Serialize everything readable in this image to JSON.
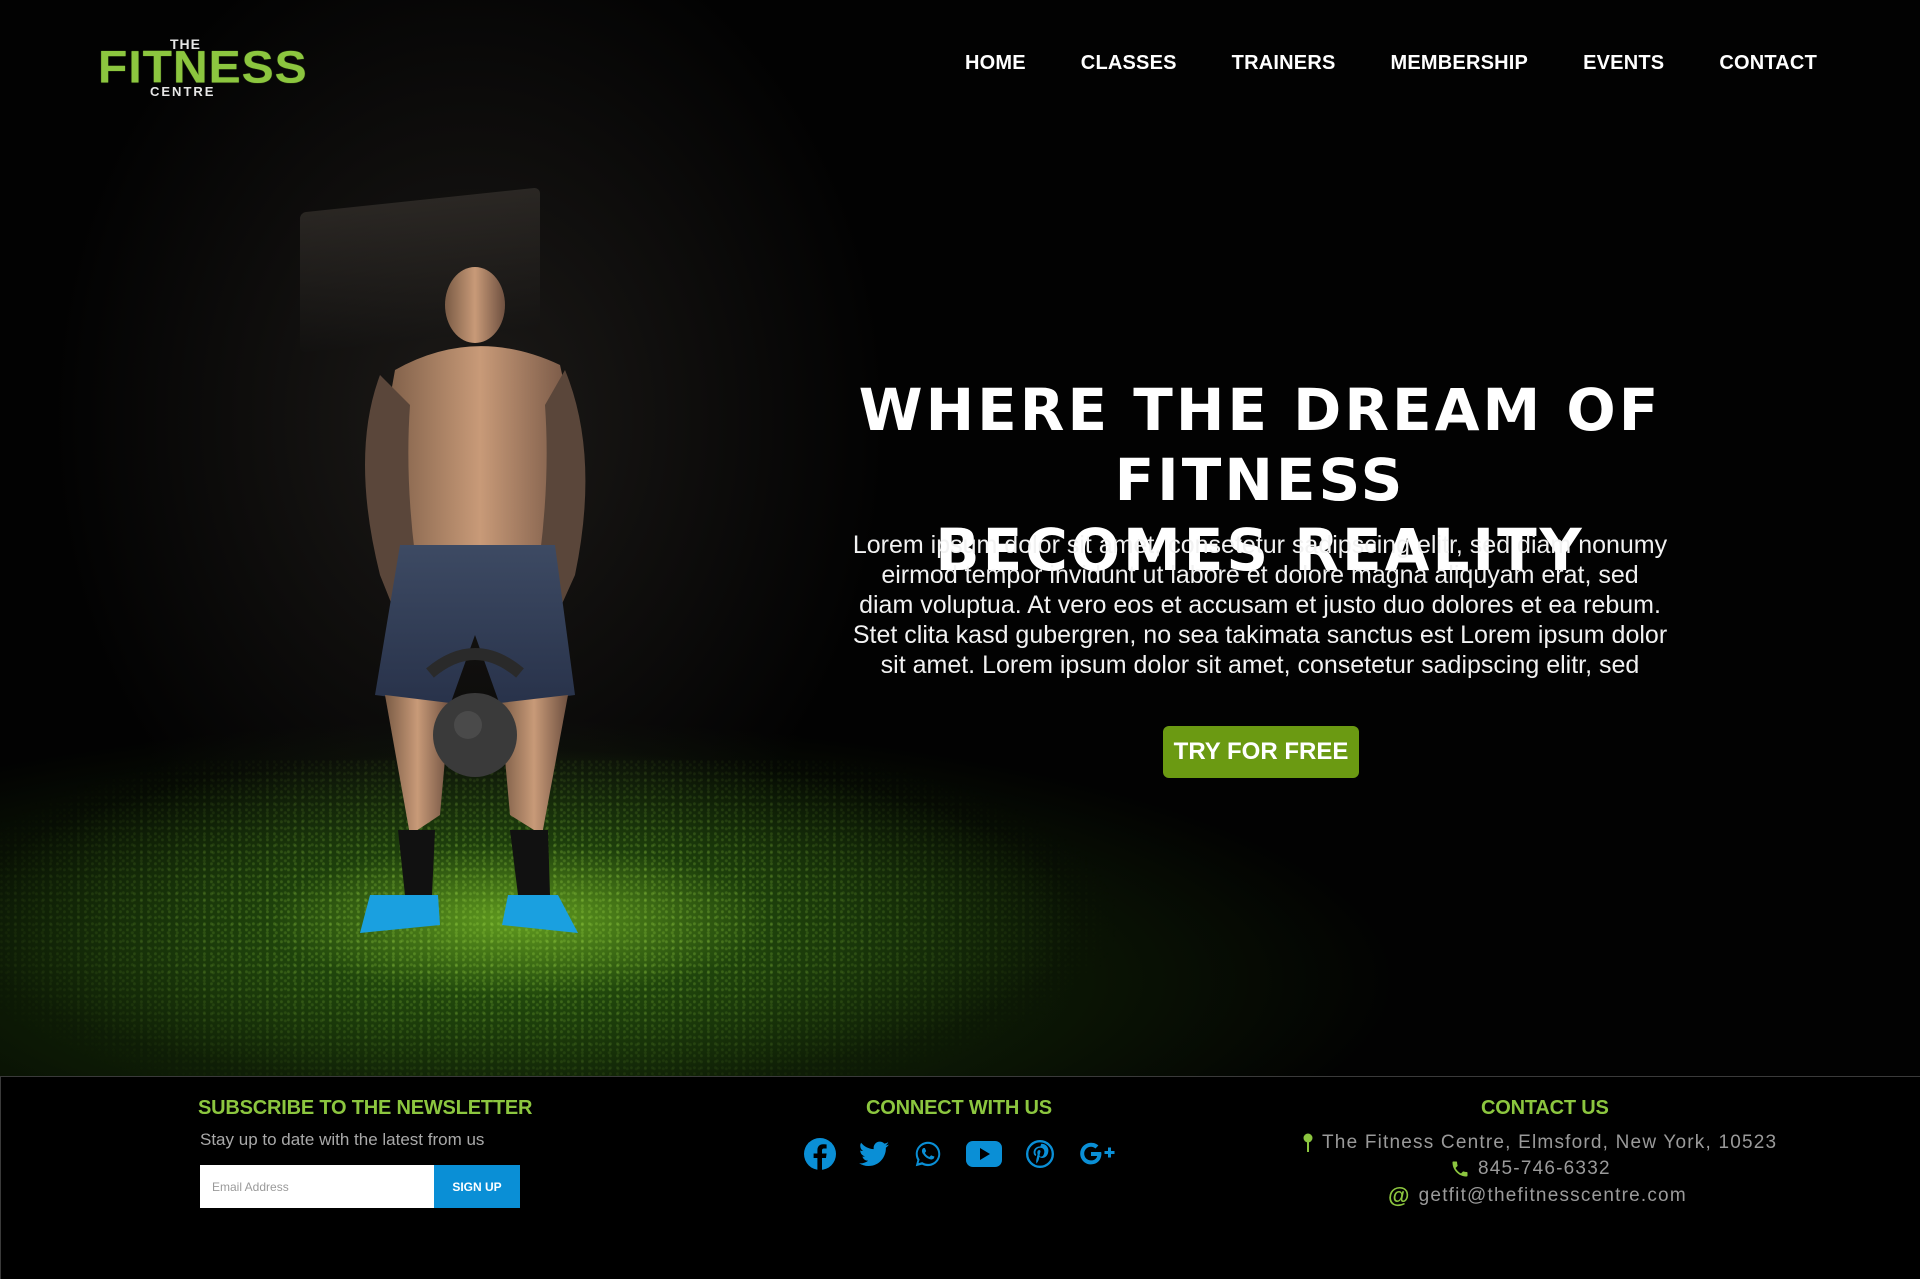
{
  "brand": {
    "the": "THE",
    "name": "FITNESS",
    "centre": "CENTRE",
    "color": "#8cc63f"
  },
  "nav": {
    "items": [
      "HOME",
      "CLASSES",
      "TRAINERS",
      "MEMBERSHIP",
      "EVENTS",
      "CONTACT"
    ]
  },
  "hero": {
    "title_line1": "WHERE THE DREAM OF FITNESS",
    "title_line2": "BECOMES REALITY",
    "description_lines": [
      "Lorem ipsum dolor sit amet, consetetur sadipscing elitr, sed diam nonumy",
      "eirmod tempor invidunt ut labore et dolore magna aliquyam erat, sed",
      "diam voluptua. At vero eos et accusam et justo duo dolores et ea rebum.",
      "Stet clita kasd gubergren, no sea takimata sanctus est Lorem ipsum dolor",
      "sit amet. Lorem ipsum dolor sit amet, consetetur sadipscing elitr, sed"
    ],
    "cta_label": "TRY FOR FREE",
    "cta_color": "#6b9a12"
  },
  "footer": {
    "newsletter": {
      "heading": "SUBSCRIBE TO THE NEWSLETTER",
      "subtext": "Stay up to date with the latest from us",
      "email_placeholder": "Email Address",
      "signup_label": "SIGN UP",
      "button_color": "#0a8fd6"
    },
    "connect": {
      "heading": "CONNECT WITH US",
      "icons": [
        "facebook-icon",
        "twitter-icon",
        "whatsapp-icon",
        "youtube-icon",
        "pinterest-icon",
        "google-plus-icon"
      ],
      "icon_color": "#0a8fd6"
    },
    "contact": {
      "heading": "CONTACT US",
      "address": "The Fitness Centre, Elmsford, New York, 10523",
      "phone": "845-746-6332",
      "email": "getfit@thefitnesscentre.com"
    }
  }
}
